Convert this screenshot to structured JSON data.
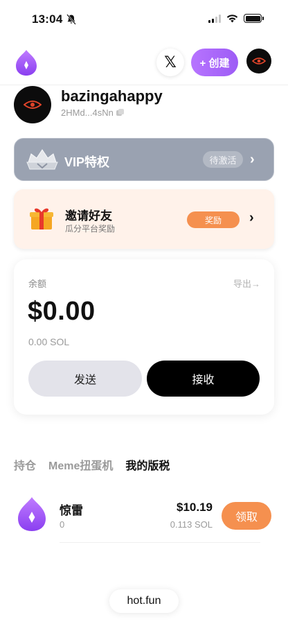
{
  "status_bar": {
    "time": "13:04"
  },
  "header": {
    "logo_icon": "flame-logo-icon",
    "x_label": "𝕏",
    "create_label": "+ 创建"
  },
  "profile": {
    "username": "bazingahappy",
    "address": "2HMd...4sNn"
  },
  "vip": {
    "label": "VIP特权",
    "status": "待激活"
  },
  "invite": {
    "title": "邀请好友",
    "subtitle": "瓜分平台奖励",
    "badge": "奖励"
  },
  "balance": {
    "label": "余额",
    "export": "导出→",
    "usd": "$0.00",
    "sol": "0.00 SOL",
    "send_label": "发送",
    "receive_label": "接收"
  },
  "tabs": [
    {
      "label": "持仓",
      "active": false
    },
    {
      "label": "Meme扭蛋机",
      "active": false
    },
    {
      "label": "我的版税",
      "active": true
    }
  ],
  "royalty": {
    "name": "惊雷",
    "count": "0",
    "usd": "$10.19",
    "sol": "0.113 SOL",
    "claim_label": "领取"
  },
  "footer": {
    "label": "hot.fun"
  },
  "colors": {
    "accent_purple": "#a865fa",
    "accent_orange": "#f5904f",
    "vip_gray": "#9aa2b1"
  }
}
